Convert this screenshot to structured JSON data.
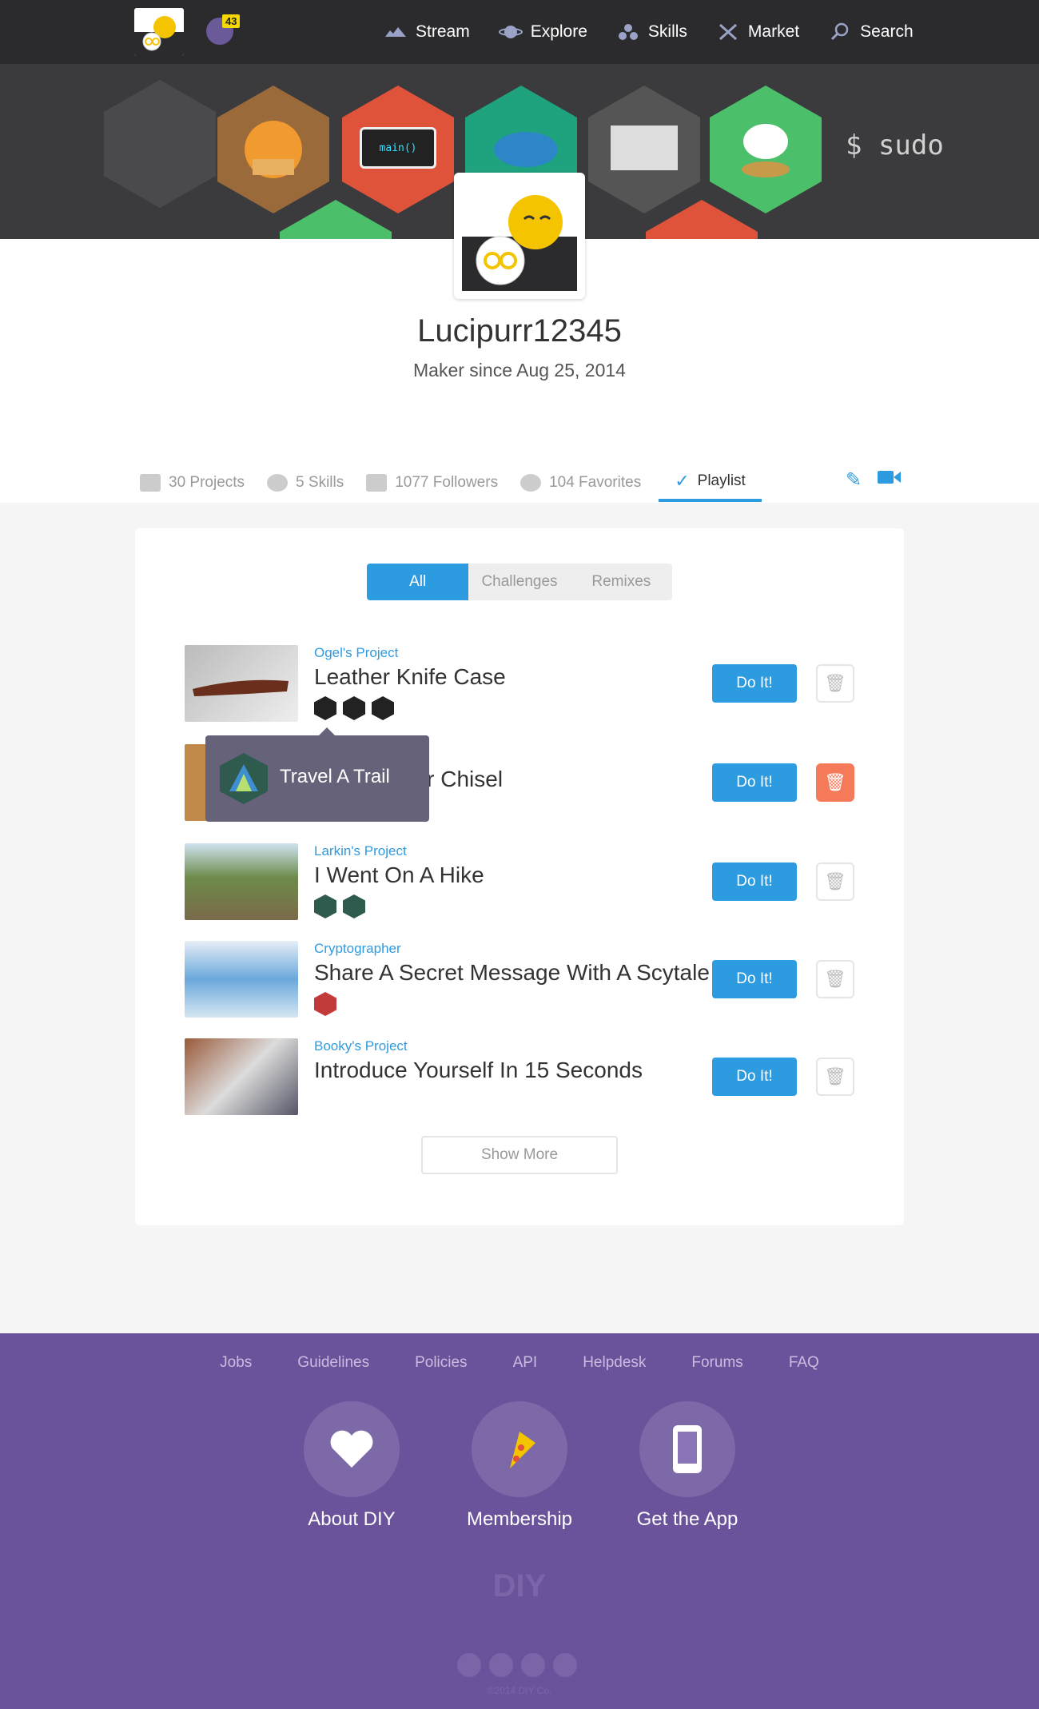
{
  "nav": {
    "notifications": "43",
    "items": [
      {
        "label": "Stream",
        "icon": "stream-icon"
      },
      {
        "label": "Explore",
        "icon": "planet-icon"
      },
      {
        "label": "Skills",
        "icon": "skills-icon"
      },
      {
        "label": "Market",
        "icon": "market-icon"
      },
      {
        "label": "Search",
        "icon": "search-icon"
      }
    ]
  },
  "hero": {
    "badge_text_main": "main()",
    "badge_text_sudo": "$ sudo"
  },
  "profile": {
    "username": "Lucipurr12345",
    "since": "Maker since Aug 25, 2014"
  },
  "tabs": [
    {
      "label": "30 Projects"
    },
    {
      "label": "5 Skills"
    },
    {
      "label": "1077 Followers"
    },
    {
      "label": "104 Favorites"
    },
    {
      "label": "Playlist"
    }
  ],
  "filters": [
    "All",
    "Challenges",
    "Remixes"
  ],
  "rows": [
    {
      "owner": "Ogel's Project",
      "title": "Leather Knife Case",
      "action": "Do It!"
    },
    {
      "owner": "",
      "title": "her Chisel",
      "action": "Do It!"
    },
    {
      "owner": "Larkin's Project",
      "title": "I Went On A Hike",
      "action": "Do It!"
    },
    {
      "owner": "Cryptographer",
      "title": "Share A Secret Message With A Scytale",
      "action": "Do It!"
    },
    {
      "owner": "Booky's Project",
      "title": "Introduce Yourself In 15 Seconds",
      "action": "Do It!"
    }
  ],
  "tooltip": {
    "label": "Travel A Trail"
  },
  "show_more": "Show More",
  "footer": {
    "links": [
      "Jobs",
      "Guidelines",
      "Policies",
      "API",
      "Helpdesk",
      "Forums",
      "FAQ"
    ],
    "cards": [
      {
        "label": "About DIY"
      },
      {
        "label": "Membership"
      },
      {
        "label": "Get the App"
      }
    ],
    "logo": "DIY",
    "copyright": "©2014 DIY Co."
  },
  "colors": {
    "accent": "#2d9be0",
    "footer": "#6a539a",
    "danger": "#f47a5a"
  }
}
